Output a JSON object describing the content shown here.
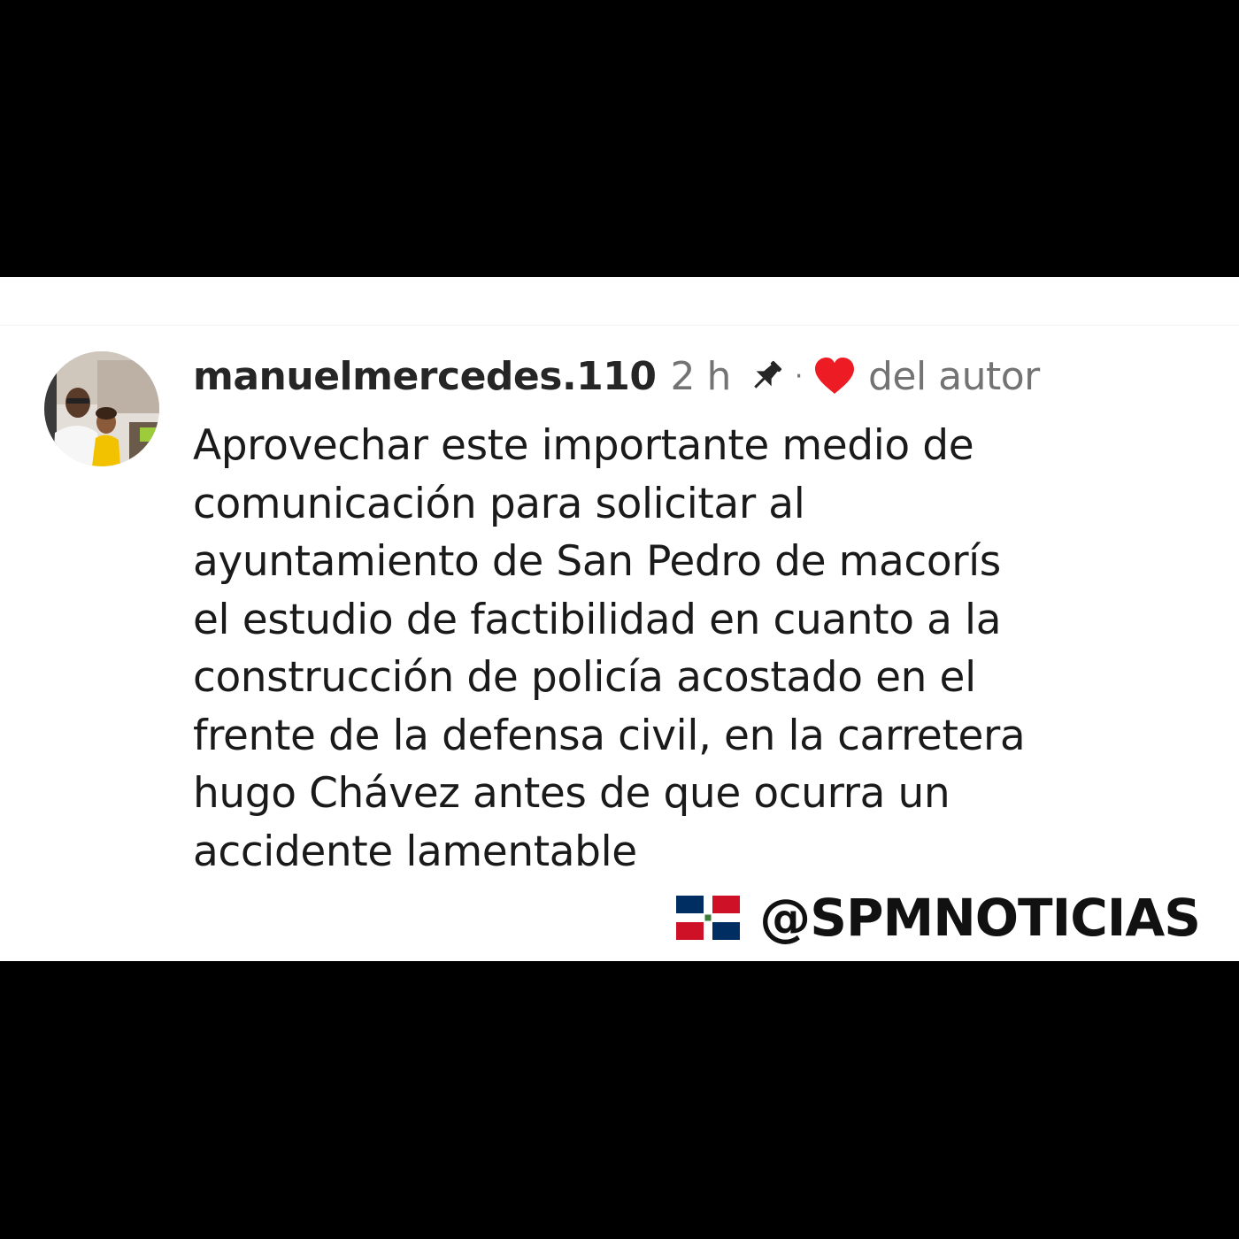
{
  "comment": {
    "username": "manuelmercedes.110",
    "timestamp": "2 h",
    "separator": "·",
    "author_label": "del autor",
    "body_lines": [
      "Aprovechar este importante medio de",
      "comunicación para solicitar al",
      "ayuntamiento de San Pedro de macorís",
      "el estudio de factibilidad en cuanto a la",
      "construcción de policía acostado en el",
      "frente de la defensa civil, en la carretera",
      "hugo Chávez antes de que ocurra un",
      "accidente lamentable"
    ],
    "avatar_icon": "user-photo-avatar",
    "pin_icon": "pushpin-icon",
    "heart_icon": "heart-icon",
    "heart_color": "#ed1c24"
  },
  "watermark": {
    "text": "@SPMNOTICIAS",
    "flag_icon": "dominican-republic-flag-icon"
  },
  "colors": {
    "background": "#000000",
    "panel": "#ffffff",
    "username": "#262626",
    "muted": "#737373",
    "body_text": "#1a1a1a",
    "flag_blue": "#002d62",
    "flag_red": "#ce1126"
  }
}
